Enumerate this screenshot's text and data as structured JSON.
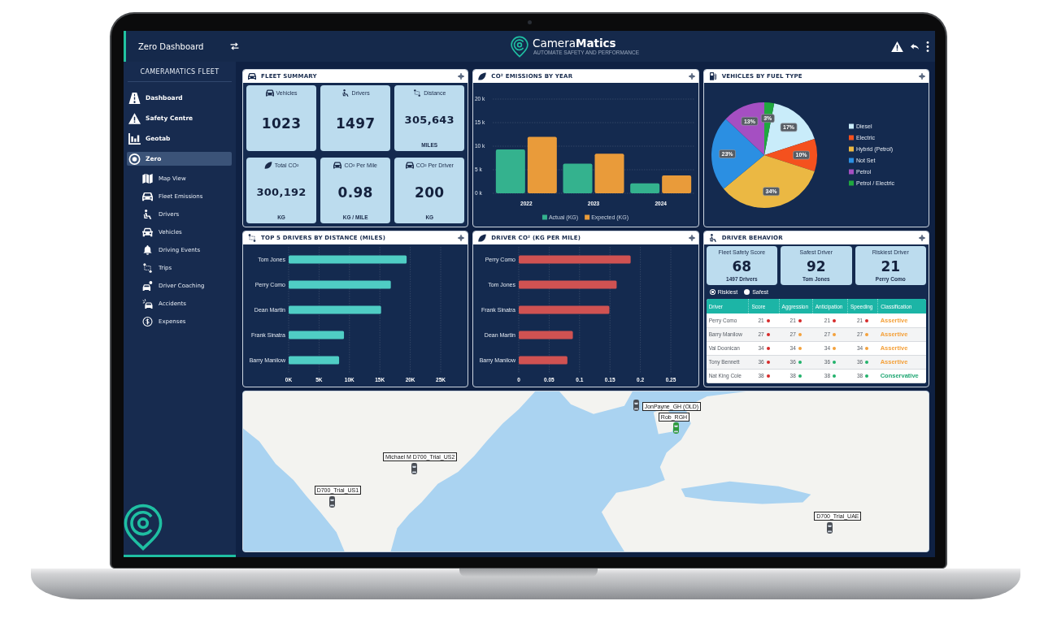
{
  "top_bar": {
    "title": "Zero Dashboard",
    "brand": "Camera**Matics**",
    "tagline": "AUTOMATE SAFETY AND PERFORMANCE"
  },
  "sidebar": {
    "heading": "CAMERAMATICS FLEET",
    "items": [
      {
        "label": "Dashboard",
        "selected": false
      },
      {
        "label": "Safety Centre",
        "selected": false
      },
      {
        "label": "Geotab",
        "selected": false
      },
      {
        "label": "Zero",
        "selected": true,
        "children": [
          {
            "label": "Map View",
            "selected": false
          },
          {
            "label": "Fleet Emissions",
            "selected": false
          },
          {
            "label": "Drivers",
            "selected": false
          },
          {
            "label": "Vehicles",
            "selected": false
          },
          {
            "label": "Driving Events",
            "selected": false
          },
          {
            "label": "Trips",
            "selected": false
          },
          {
            "label": "Driver Coaching",
            "selected": false
          },
          {
            "label": "Accidents",
            "selected": false
          },
          {
            "label": "Expenses",
            "selected": false
          }
        ]
      }
    ]
  },
  "fleet_summary": {
    "title": "FLEET SUMMARY",
    "tiles": [
      {
        "label": "Vehicles",
        "value": "1023"
      },
      {
        "label": "Drivers",
        "value": "1497"
      },
      {
        "label": "Distance",
        "value": "305,643",
        "unit": "MILES"
      },
      {
        "label": "Total CO²",
        "value": "300,192",
        "unit": "KG"
      },
      {
        "label": "CO² Per Mile",
        "value": "0.98",
        "unit": "KG / MILE"
      },
      {
        "label": "CO² Per Driver",
        "value": "200",
        "unit": "KG"
      }
    ]
  },
  "co2_by_year": {
    "title": "CO² EMISSIONS BY YEAR",
    "chart_data": {
      "type": "bar",
      "categories": [
        "2022",
        "2023",
        "2024"
      ],
      "series": [
        {
          "name": "Actual (KG)",
          "color": "#34b28e",
          "values": [
            9300,
            6300,
            2100
          ]
        },
        {
          "name": "Expected (KG)",
          "color": "#e99b3a",
          "values": [
            12000,
            8400,
            3800
          ]
        }
      ],
      "ylim": [
        0,
        20000
      ],
      "yticks": [
        {
          "value": 0,
          "label": "0 k"
        },
        {
          "value": 5000,
          "label": "5 k"
        },
        {
          "value": 10000,
          "label": "10 k"
        },
        {
          "value": 15000,
          "label": "15 k"
        },
        {
          "value": 20000,
          "label": "20 k"
        }
      ],
      "grid": true,
      "legend": "bottom"
    }
  },
  "fuel_type": {
    "title": "VEHICLES BY FUEL TYPE",
    "chart_data": {
      "type": "pie",
      "categories": [
        "Diesel",
        "Electric",
        "Hybrid (Petrol)",
        "Not Set",
        "Petrol",
        "Petrol / Electric"
      ],
      "values": [
        17,
        10,
        34,
        23,
        13,
        3
      ],
      "colors": [
        "#c9ecfa",
        "#f4511e",
        "#ebb843",
        "#2b8fe2",
        "#a54fc2",
        "#20a83e"
      ],
      "value_labels": [
        "17%",
        "10%",
        "34%",
        "23%",
        "13%",
        "3%"
      ],
      "legend": "right"
    }
  },
  "top_drivers": {
    "title": "TOP 5 DRIVERS BY DISTANCE (MILES)",
    "chart_data": {
      "type": "bar",
      "orientation": "horizontal",
      "categories": [
        "Tom Jones",
        "Perry Como",
        "Dean Martin",
        "Frank Sinatra",
        "Barry Manilow"
      ],
      "series": [
        {
          "color": "#4fcdc4",
          "values": [
            19400,
            16800,
            15200,
            9100,
            8300
          ]
        }
      ],
      "xlim": [
        0,
        25000
      ],
      "xticks": [
        {
          "value": 0,
          "label": "0K"
        },
        {
          "value": 5000,
          "label": "5K"
        },
        {
          "value": 10000,
          "label": "10K"
        },
        {
          "value": 15000,
          "label": "15K"
        },
        {
          "value": 20000,
          "label": "20K"
        },
        {
          "value": 25000,
          "label": "25K"
        }
      ],
      "grid": true
    }
  },
  "driver_co2": {
    "title": "DRIVER CO² (KG PER MILE)",
    "chart_data": {
      "type": "bar",
      "orientation": "horizontal",
      "categories": [
        "Perry Como",
        "Tom Jones",
        "Frank Sinatra",
        "Dean Martin",
        "Barry Manilow"
      ],
      "series": [
        {
          "color": "#d05252",
          "values": [
            0.184,
            0.161,
            0.149,
            0.089,
            0.08
          ]
        }
      ],
      "xlim": [
        0,
        0.25
      ],
      "xticks": [
        0,
        0.05,
        0.1,
        0.15,
        0.2,
        0.25
      ],
      "grid": true
    }
  },
  "driver_behavior": {
    "title": "DRIVER BEHAVIOR",
    "stats": [
      {
        "label": "Fleet Safety Score",
        "value": "68",
        "caption": "1497 Drivers"
      },
      {
        "label": "Safest Driver",
        "value": "92",
        "caption": "Tom Jones"
      },
      {
        "label": "Riskiest Driver",
        "value": "21",
        "caption": "Perry Como"
      }
    ],
    "filter": [
      {
        "label": "Riskiest",
        "selected": true
      },
      {
        "label": "Safest",
        "selected": false
      }
    ],
    "table": {
      "columns": [
        "Driver",
        "Score",
        "Aggression",
        "Anticipation",
        "Speeding",
        "Classification"
      ],
      "rows": [
        {
          "driver": "Perry Como",
          "scores": [
            {
              "value": "21",
              "color": "#d62a2a"
            },
            {
              "value": "21",
              "color": "#d62a2a"
            },
            {
              "value": "21",
              "color": "#d62a2a"
            },
            {
              "value": "21",
              "color": "#d62a2a"
            }
          ],
          "classification": {
            "text": "Assertive",
            "color": "#f4a13b"
          }
        },
        {
          "driver": "Barry Manilow",
          "scores": [
            {
              "value": "27",
              "color": "#d62a2a"
            },
            {
              "value": "27",
              "color": "#f4a13b"
            },
            {
              "value": "27",
              "color": "#f4a13b"
            },
            {
              "value": "27",
              "color": "#f4a13b"
            }
          ],
          "classification": {
            "text": "Assertive",
            "color": "#f4a13b"
          }
        },
        {
          "driver": "Val Doonican",
          "scores": [
            {
              "value": "34",
              "color": "#d62a2a"
            },
            {
              "value": "34",
              "color": "#f4a13b"
            },
            {
              "value": "34",
              "color": "#f4a13b"
            },
            {
              "value": "34",
              "color": "#f4a13b"
            }
          ],
          "classification": {
            "text": "Assertive",
            "color": "#f4a13b"
          }
        },
        {
          "driver": "Tony Bennett",
          "scores": [
            {
              "value": "36",
              "color": "#d62a2a"
            },
            {
              "value": "36",
              "color": "#22b26b"
            },
            {
              "value": "36",
              "color": "#22b26b"
            },
            {
              "value": "36",
              "color": "#22b26b"
            }
          ],
          "classification": {
            "text": "Assertive",
            "color": "#f4a13b"
          }
        },
        {
          "driver": "Nat King Cole",
          "scores": [
            {
              "value": "38",
              "color": "#d62a2a"
            },
            {
              "value": "38",
              "color": "#22b26b"
            },
            {
              "value": "38",
              "color": "#22b26b"
            },
            {
              "value": "38",
              "color": "#22b26b"
            }
          ],
          "classification": {
            "text": "Conservative",
            "color": "#1ea672"
          }
        }
      ]
    }
  },
  "map": {
    "markers": [
      {
        "label": "JonPayne_GH (OLD)",
        "color": "#4a4e55"
      },
      {
        "label": "Rob_RGH",
        "color": "#2f9a3c"
      },
      {
        "label": "Michael M D700_Trial_US2",
        "color": "#4a4e55"
      },
      {
        "label": "D700_Trial_US1",
        "color": "#4a4e55"
      },
      {
        "label": "D700_Trial_UAE",
        "color": "#4a4e55"
      }
    ]
  }
}
